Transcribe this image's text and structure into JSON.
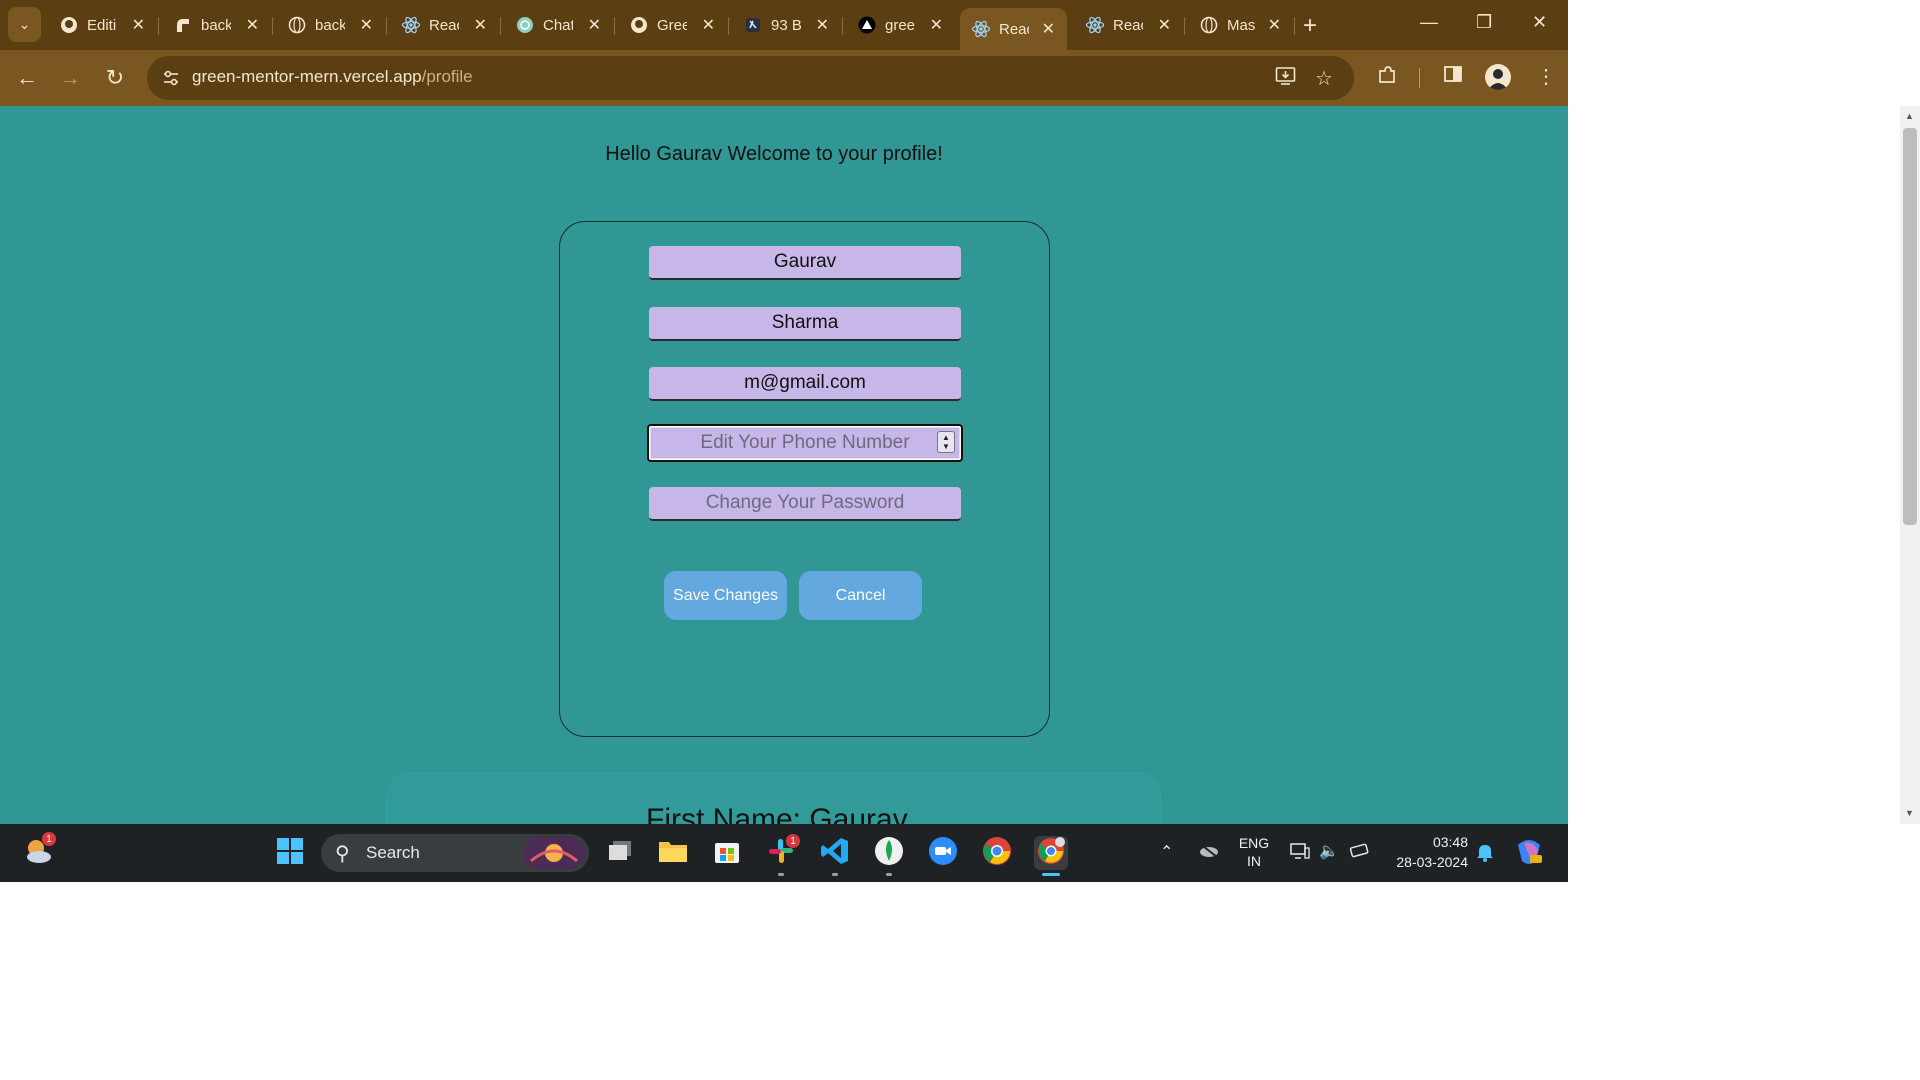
{
  "browser": {
    "tabs": [
      {
        "label": "Editi",
        "icon": "github-icon"
      },
      {
        "label": "back",
        "icon": "render-icon"
      },
      {
        "label": "back",
        "icon": "globe-icon"
      },
      {
        "label": "Reac",
        "icon": "react-icon"
      },
      {
        "label": "Chat",
        "icon": "chatgpt-icon"
      },
      {
        "label": "Gree",
        "icon": "github-icon"
      },
      {
        "label": "93 B",
        "icon": "bookmark-icon"
      },
      {
        "label": "gree",
        "icon": "vercel-icon"
      },
      {
        "label": "Reac",
        "icon": "react-icon",
        "active": true
      },
      {
        "label": "Reac",
        "icon": "react-icon"
      },
      {
        "label": "Mas",
        "icon": "globe-icon"
      }
    ],
    "url_domain": "green-mentor-mern.vercel.app",
    "url_path": "/profile"
  },
  "page": {
    "greeting": "Hello Gaurav Welcome to your profile!",
    "form": {
      "first_name_value": "Gaurav",
      "last_name_value": "Sharma",
      "email_value": "m@gmail.com",
      "phone_placeholder": "Edit Your Phone Number",
      "password_placeholder": "Change Your Password",
      "save_label": "Save Changes",
      "cancel_label": "Cancel"
    },
    "details_first_name": "First Name: Gaurav"
  },
  "taskbar": {
    "search_label": "Search",
    "lang_line1": "ENG",
    "lang_line2": "IN",
    "time": "03:48",
    "date": "28-03-2024",
    "weather_badge": "1",
    "slack_badge": "1"
  },
  "colors": {
    "page_bg": "#319795",
    "field_bg": "#c7b7e8",
    "button_bg": "#63a9e0",
    "chrome_bg": "#7a5620"
  }
}
